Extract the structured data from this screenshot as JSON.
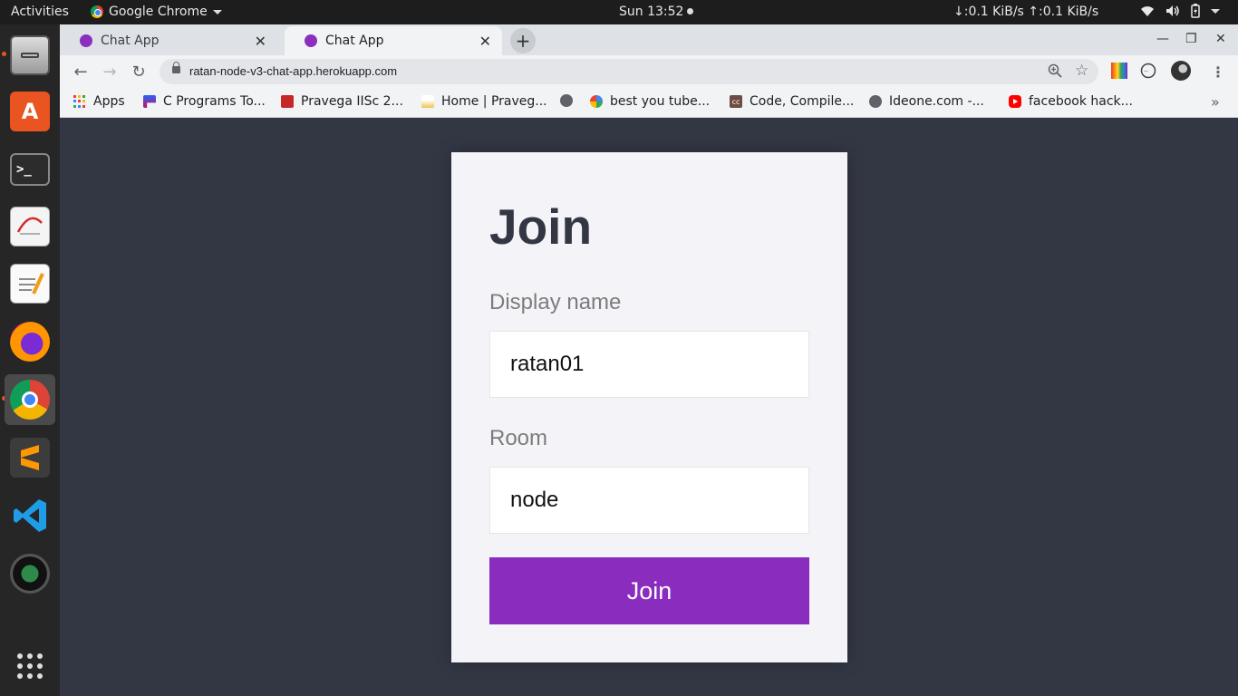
{
  "topbar": {
    "activities": "Activities",
    "app_name": "Google Chrome",
    "clock": "Sun 13:52",
    "netspeed": "↓:0.1 KiB/s ↑:0.1 KiB/s"
  },
  "dock": {
    "items": [
      "files",
      "software-center",
      "terminal",
      "document-viewer",
      "text-editor",
      "firefox",
      "chrome",
      "sublime-text",
      "vscode",
      "camera",
      "show-applications"
    ]
  },
  "browser": {
    "tabs": [
      {
        "title": "Chat App",
        "active": false
      },
      {
        "title": "Chat App",
        "active": true
      }
    ],
    "url": "ratan-node-v3-chat-app.herokuapp.com",
    "bookmarks": [
      {
        "label": "Apps",
        "icon": "apps-grid-icon"
      },
      {
        "label": "C Programs To...",
        "icon": "p-logo-icon"
      },
      {
        "label": "Pravega IISc 2...",
        "icon": "pravega-icon"
      },
      {
        "label": "Home | Praveg...",
        "icon": "pravega-torch-icon"
      },
      {
        "label": "",
        "icon": "globe-icon"
      },
      {
        "label": "best you tube...",
        "icon": "google-icon"
      },
      {
        "label": "Code, Compile...",
        "icon": "cc-icon"
      },
      {
        "label": "Ideone.com -...",
        "icon": "globe-icon"
      },
      {
        "label": "facebook hack...",
        "icon": "youtube-icon"
      }
    ],
    "colors": {
      "tab_favicon": "#8b2fbf"
    }
  },
  "join_form": {
    "heading": "Join",
    "display_name_label": "Display name",
    "display_name_value": "ratan01",
    "room_label": "Room",
    "room_value": "node",
    "submit_label": "Join",
    "colors": {
      "button": "#8a2cbe",
      "page_bg": "#333744",
      "card_bg": "#f4f3f8"
    }
  }
}
